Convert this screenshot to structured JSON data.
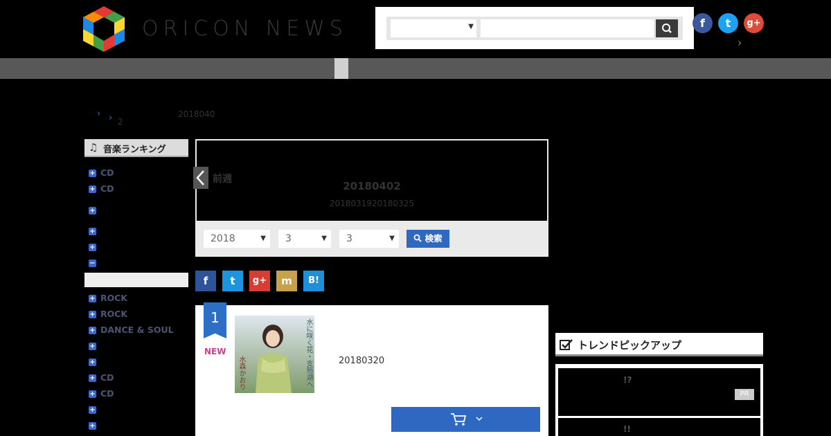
{
  "header": {
    "logo_text": "ORICON NEWS",
    "search_select_value": "",
    "search_placeholder": "",
    "sns": [
      {
        "name": "facebook",
        "glyph": "f",
        "color": "#3b5998"
      },
      {
        "name": "twitter",
        "glyph": "t",
        "color": "#1da1f2"
      },
      {
        "name": "google-plus",
        "glyph": "g+",
        "color": "#dd4b39"
      }
    ],
    "header_link_arrow": "›"
  },
  "breadcrumb": {
    "level2": "2",
    "date": "2018040"
  },
  "sidebar": {
    "heading": "音楽ランキング",
    "items": [
      {
        "label": "CD",
        "sign": "+"
      },
      {
        "label": "CD",
        "sign": "+"
      },
      {
        "label": "",
        "sign": "+"
      },
      {
        "label": "",
        "sign": "+"
      },
      {
        "label": "",
        "sign": "+"
      },
      {
        "label": "",
        "sign": "−"
      },
      {
        "label": "ROCK",
        "sign": "+"
      },
      {
        "label": "ROCK",
        "sign": "+"
      },
      {
        "label": "DANCE & SOUL",
        "sign": "+"
      },
      {
        "label": "",
        "sign": "+"
      },
      {
        "label": "",
        "sign": "+"
      },
      {
        "label": "CD",
        "sign": "+"
      },
      {
        "label": "CD",
        "sign": "+"
      },
      {
        "label": "",
        "sign": "+"
      },
      {
        "label": "",
        "sign": "+"
      }
    ]
  },
  "week": {
    "prev_label": "前週",
    "title": "20180402",
    "subtitle": "2018031920180325",
    "year_value": "2018",
    "month_value": "3",
    "week_value": "3",
    "search_label": "検索"
  },
  "share": [
    {
      "name": "facebook",
      "glyph": "f",
      "color": "#2c5496"
    },
    {
      "name": "twitter",
      "glyph": "t",
      "color": "#1b95e0"
    },
    {
      "name": "google-plus",
      "glyph": "g+",
      "color": "#d73d32"
    },
    {
      "name": "mixi",
      "glyph": "m",
      "color": "#c9a04b"
    },
    {
      "name": "hatena",
      "glyph": "B!",
      "color": "#1e8fd9"
    }
  ],
  "ranking": {
    "rank": "1",
    "new_label": "NEW",
    "jacket_text_right": "水に咲く花・支笏湖へ",
    "jacket_text_left": "水森かおり",
    "release_date": "20180320"
  },
  "trend": {
    "heading": "トレンドピックアップ",
    "item1_text": "!?",
    "item2_text": "!!",
    "pr_label": "PR"
  }
}
